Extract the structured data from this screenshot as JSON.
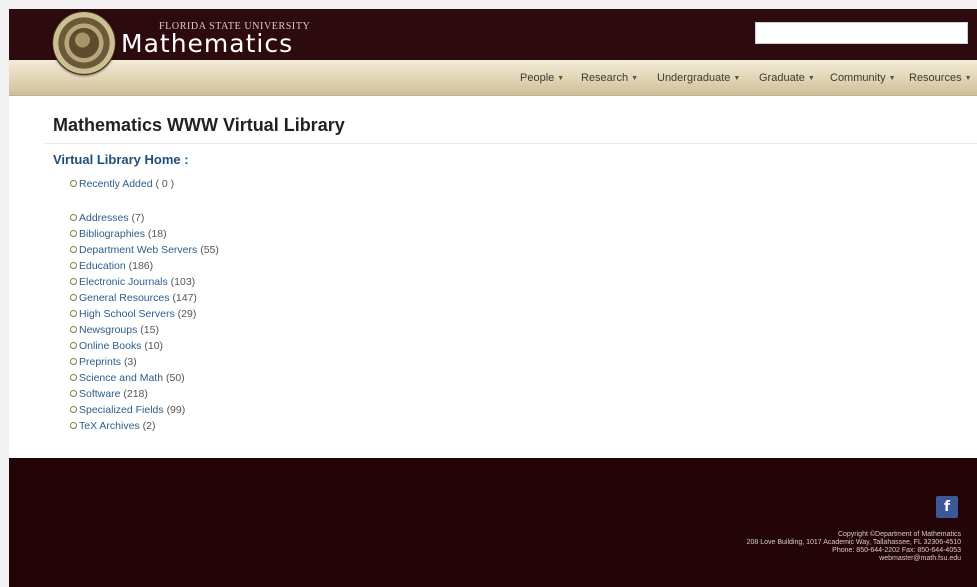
{
  "header": {
    "university": "FLORIDA STATE UNIVERSITY",
    "department": "Mathematics",
    "search_placeholder": ""
  },
  "nav": {
    "items": [
      {
        "label": "People"
      },
      {
        "label": "Research"
      },
      {
        "label": "Undergraduate"
      },
      {
        "label": "Graduate"
      },
      {
        "label": "Community"
      },
      {
        "label": "Resources"
      }
    ]
  },
  "main": {
    "title": "Mathematics WWW Virtual Library",
    "subtitle": "Virtual Library Home :",
    "recent": {
      "label": "Recently Added",
      "count": "( 0 )"
    },
    "categories": [
      {
        "label": "Addresses",
        "count": "(7)"
      },
      {
        "label": "Bibliographies",
        "count": "(18)"
      },
      {
        "label": "Department Web Servers",
        "count": "(55)"
      },
      {
        "label": "Education",
        "count": "(186)"
      },
      {
        "label": "Electronic Journals",
        "count": "(103)"
      },
      {
        "label": "General Resources",
        "count": "(147)"
      },
      {
        "label": "High School Servers",
        "count": "(29)"
      },
      {
        "label": "Newsgroups",
        "count": "(15)"
      },
      {
        "label": "Online Books",
        "count": "(10)"
      },
      {
        "label": "Preprints",
        "count": "(3)"
      },
      {
        "label": "Science and Math",
        "count": "(50)"
      },
      {
        "label": "Software",
        "count": "(218)"
      },
      {
        "label": "Specialized Fields",
        "count": "(99)"
      },
      {
        "label": "TeX Archives",
        "count": "(2)"
      }
    ]
  },
  "footer": {
    "facebook_glyph": "f",
    "copyright": "Copyright ©Department of Mathematics",
    "address": "208 Love Building, 1017 Academic Way, Tallahassee, FL 32306-4510",
    "phone": "Phone: 850-644-2202 Fax: 850-644-4053",
    "email": "webmaster@math.fsu.edu"
  },
  "colors": {
    "header_bg": "#2d0a0e",
    "footer_bg": "#230407",
    "navbar_bg": "#e1d4b3",
    "link": "#2b5d8c",
    "subtitle": "#1f4e79"
  }
}
